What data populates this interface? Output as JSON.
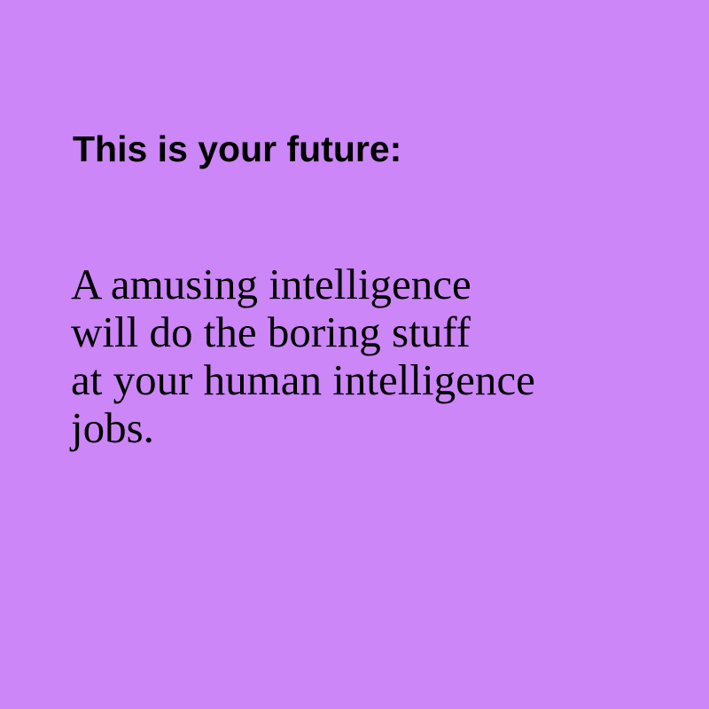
{
  "background_color": "#cc86f8",
  "text_color": "#000000",
  "heading": "This is your future:",
  "body_lines": [
    "A amusing intelligence",
    "will do the boring stuff",
    "at your human intelligence",
    "jobs."
  ]
}
